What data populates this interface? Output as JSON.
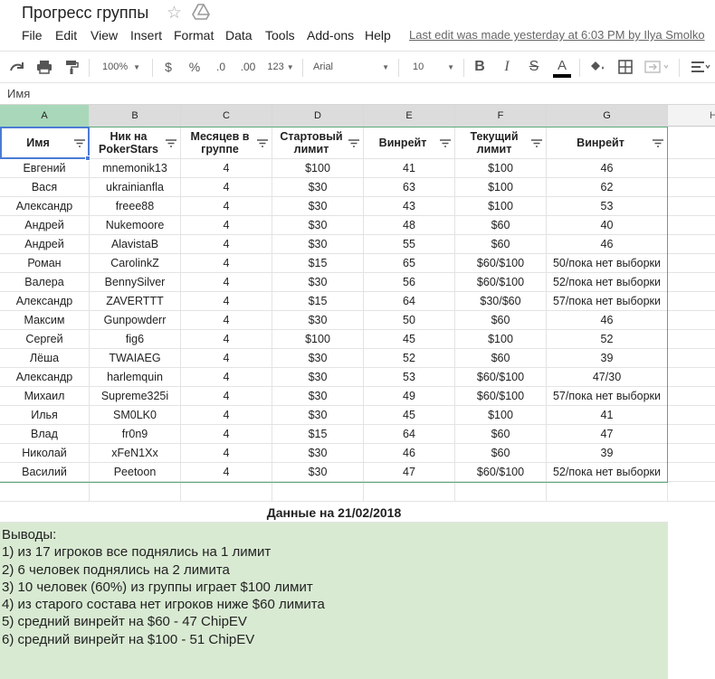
{
  "app": {
    "title": "Прогресс группы",
    "last_edit": "Last edit was made yesterday at 6:03 PM by Ilya Smolko"
  },
  "menu": [
    "File",
    "Edit",
    "View",
    "Insert",
    "Format",
    "Data",
    "Tools",
    "Add-ons",
    "Help"
  ],
  "toolbar": {
    "zoom": "100%",
    "currency": "$",
    "percent": "%",
    "decrease_decimals": ".0",
    "increase_decimals": ".00",
    "more_formats": "123",
    "font": "Arial",
    "font_size": "10",
    "bold": "B",
    "italic": "I",
    "strike": "S",
    "text_color_letter": "A",
    "text_color": "#000000"
  },
  "formula_bar": {
    "content": "Имя"
  },
  "columns": [
    "A",
    "B",
    "C",
    "D",
    "E",
    "F",
    "G",
    "H"
  ],
  "table": {
    "headers": [
      "Имя",
      "Ник на PokerStars",
      "Месяцев в группе",
      "Стартовый лимит",
      "Винрейт",
      "Текущий лимит",
      "Винрейт"
    ],
    "rows": [
      [
        "Евгений",
        "mnemonik13",
        "4",
        "$100",
        "41",
        "$100",
        "46"
      ],
      [
        "Вася",
        "ukrainianfla",
        "4",
        "$30",
        "63",
        "$100",
        "62"
      ],
      [
        "Александр",
        "freee88",
        "4",
        "$30",
        "43",
        "$100",
        "53"
      ],
      [
        "Андрей",
        "Nukemoore",
        "4",
        "$30",
        "48",
        "$60",
        "40"
      ],
      [
        "Андрей",
        "AlavistaB",
        "4",
        "$30",
        "55",
        "$60",
        "46"
      ],
      [
        "Роман",
        "CarolinkZ",
        "4",
        "$15",
        "65",
        "$60/$100",
        "50/пока нет выборки"
      ],
      [
        "Валера",
        "BennySilver",
        "4",
        "$30",
        "56",
        "$60/$100",
        "52/пока нет выборки"
      ],
      [
        "Александр",
        "ZAVERTTT",
        "4",
        "$15",
        "64",
        "$30/$60",
        "57/пока нет выборки"
      ],
      [
        "Максим",
        "Gunpowderr",
        "4",
        "$30",
        "50",
        "$60",
        "46"
      ],
      [
        "Сергей",
        "fig6",
        "4",
        "$100",
        "45",
        "$100",
        "52"
      ],
      [
        "Лёша",
        "TWAIAEG",
        "4",
        "$30",
        "52",
        "$60",
        "39"
      ],
      [
        "Александр",
        "harlemquin",
        "4",
        "$30",
        "53",
        "$60/$100",
        "47/30"
      ],
      [
        "Михаил",
        "Supreme325i",
        "4",
        "$30",
        "49",
        "$60/$100",
        "57/пока нет выборки"
      ],
      [
        "Илья",
        "SM0LK0",
        "4",
        "$30",
        "45",
        "$100",
        "41"
      ],
      [
        "Влад",
        "fr0n9",
        "4",
        "$15",
        "64",
        "$60",
        "47"
      ],
      [
        "Николай",
        "xFeN1Xx",
        "4",
        "$30",
        "46",
        "$60",
        "39"
      ],
      [
        "Василий",
        "Peetoon",
        "4",
        "$30",
        "47",
        "$60/$100",
        "52/пока нет выборки"
      ]
    ]
  },
  "date_note": "Данные на 21/02/2018",
  "conclusions": [
    "Выводы:",
    "1) из 17 игроков все поднялись на 1 лимит",
    "2) 6 человек поднялись на 2 лимита",
    "3) 10 человек (60%) из группы играет $100 лимит",
    "4) из старого состава нет игроков ниже $60 лимита",
    "5) средний винрейт на $60 - 47 ChipEV",
    "6) средний винрейт на $100 - 51 ChipEV"
  ],
  "colors": {
    "header_selected": "#a8d8b9",
    "conclusions_bg": "#d9ead3",
    "selection": "#4a7bd4"
  }
}
